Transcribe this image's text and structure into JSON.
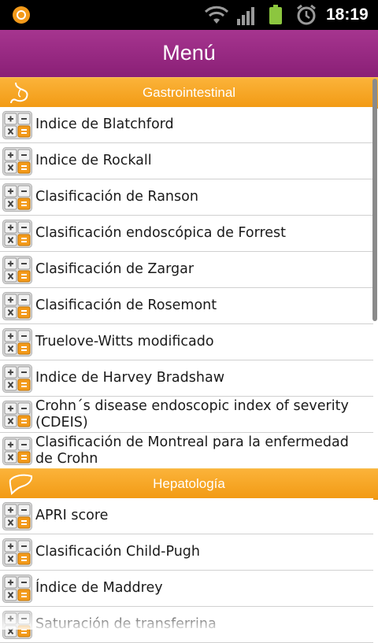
{
  "status_bar": {
    "time": "18:19",
    "icons": [
      "app-notification-icon",
      "wifi-icon",
      "signal-icon",
      "battery-icon",
      "alarm-icon"
    ]
  },
  "title_bar": {
    "title": "Menú"
  },
  "sections": [
    {
      "label": "Gastrointestinal",
      "icon": "stomach-icon",
      "items": [
        "Indice de Blatchford",
        "Indice de Rockall",
        "Clasificación de Ranson",
        "Clasificación endoscópica de Forrest",
        "Clasificación de Zargar",
        "Clasificación de Rosemont",
        "Truelove-Witts modificado",
        "Indice de Harvey Bradshaw",
        "Crohn´s disease endoscopic index of severity (CDEIS)",
        "Clasificación de Montreal para la enfermedad de Crohn"
      ]
    },
    {
      "label": "Hepatología",
      "icon": "liver-icon",
      "items": [
        "APRI score",
        "Clasificación Child-Pugh",
        "Índice de Maddrey",
        "Saturación de transferrina"
      ]
    }
  ],
  "colors": {
    "title_bar": "#9a2a86",
    "section_header": "#f5a623",
    "divider": "#d0d0d0"
  }
}
